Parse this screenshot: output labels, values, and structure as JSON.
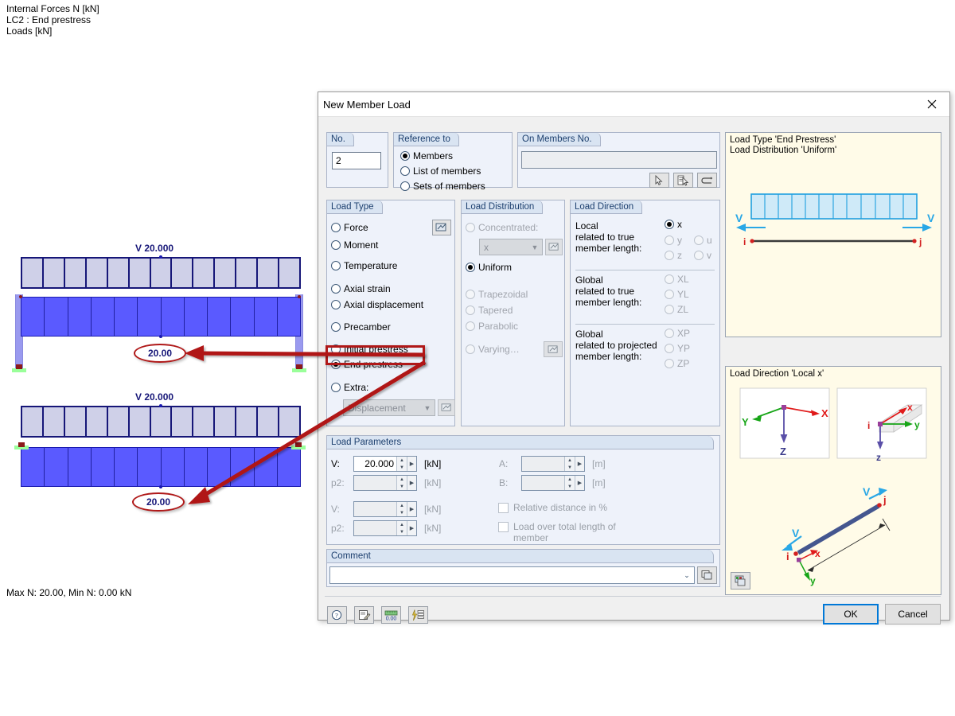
{
  "background": {
    "legend": "Internal Forces N [kN]\nLC2 : End prestress\nLoads [kN]",
    "status": "Max N: 20.00, Min N: 0.00 kN",
    "beam1_label": "V 20.000",
    "beam1_value": "20.00",
    "beam2_label": "V 20.000",
    "beam2_value": "20.00"
  },
  "dialog": {
    "title": "New Member Load",
    "close_icon": "close-icon",
    "no": {
      "title": "No.",
      "value": "2"
    },
    "reference_to": {
      "title": "Reference to",
      "options": [
        {
          "label": "Members",
          "selected": true
        },
        {
          "label": "List of members",
          "selected": false
        },
        {
          "label": "Sets of members",
          "selected": false
        }
      ]
    },
    "on_members": {
      "title": "On Members No.",
      "value": "",
      "buttons": [
        {
          "name": "pick-members-icon"
        },
        {
          "name": "pick-members-list-icon"
        },
        {
          "name": "undo-selection-icon"
        }
      ]
    },
    "load_type": {
      "title": "Load Type",
      "options": [
        {
          "label": "Force",
          "selected": false,
          "disabled": false
        },
        {
          "label": "Moment",
          "selected": false,
          "disabled": false
        },
        {
          "label": "Temperature",
          "selected": false,
          "disabled": false
        },
        {
          "label": "Axial strain",
          "selected": false,
          "disabled": false
        },
        {
          "label": "Axial displacement",
          "selected": false,
          "disabled": false
        },
        {
          "label": "Precamber",
          "selected": false,
          "disabled": false
        },
        {
          "label": "Initial prestress",
          "selected": false,
          "disabled": false
        },
        {
          "label": "End prestress",
          "selected": true,
          "disabled": false
        },
        {
          "label": "Extra:",
          "selected": false,
          "disabled": false
        }
      ],
      "extra_combo_value": "Displacement",
      "highlighted_option": "End prestress"
    },
    "load_distribution": {
      "title": "Load Distribution",
      "options": [
        {
          "label": "Concentrated:",
          "selected": false,
          "disabled": true
        },
        {
          "label": "Uniform",
          "selected": true,
          "disabled": false
        },
        {
          "label": "Trapezoidal",
          "selected": false,
          "disabled": true
        },
        {
          "label": "Tapered",
          "selected": false,
          "disabled": true
        },
        {
          "label": "Parabolic",
          "selected": false,
          "disabled": true
        },
        {
          "label": "Varying…",
          "selected": false,
          "disabled": true
        }
      ],
      "concentrated_combo_value": "x"
    },
    "load_direction": {
      "title": "Load Direction",
      "groups": [
        {
          "label": "Local\nrelated to true\nmember length:",
          "options": [
            {
              "label": "x",
              "selected": true,
              "disabled": false
            },
            {
              "label": "y",
              "selected": false,
              "disabled": true
            },
            {
              "label": "u",
              "selected": false,
              "disabled": true
            },
            {
              "label": "z",
              "selected": false,
              "disabled": true
            },
            {
              "label": "v",
              "selected": false,
              "disabled": true
            }
          ]
        },
        {
          "label": "Global\nrelated to true\nmember length:",
          "options": [
            {
              "label": "XL",
              "selected": false,
              "disabled": true
            },
            {
              "label": "YL",
              "selected": false,
              "disabled": true
            },
            {
              "label": "ZL",
              "selected": false,
              "disabled": true
            }
          ]
        },
        {
          "label": "Global\nrelated to projected\nmember length:",
          "options": [
            {
              "label": "XP",
              "selected": false,
              "disabled": true
            },
            {
              "label": "YP",
              "selected": false,
              "disabled": true
            },
            {
              "label": "ZP",
              "selected": false,
              "disabled": true
            }
          ]
        }
      ]
    },
    "load_parameters": {
      "title": "Load Parameters",
      "fields": [
        {
          "label": "V:",
          "value": "20.000",
          "unit": "[kN]",
          "disabled": false
        },
        {
          "label": "p2:",
          "value": "",
          "unit": "[kN]",
          "disabled": true
        },
        {
          "label": "V:",
          "value": "",
          "unit": "[kN]",
          "disabled": true
        },
        {
          "label": "p2:",
          "value": "",
          "unit": "[kN]",
          "disabled": true
        },
        {
          "label": "A:",
          "value": "",
          "unit": "[m]",
          "disabled": true
        },
        {
          "label": "B:",
          "value": "",
          "unit": "[m]",
          "disabled": true
        }
      ],
      "checkboxes": [
        {
          "label": "Relative distance in %",
          "checked": false,
          "disabled": true
        },
        {
          "label": "Load over total length of member",
          "checked": false,
          "disabled": true
        }
      ]
    },
    "comment": {
      "title": "Comment",
      "value": "",
      "button_icon": "comment-library-icon"
    },
    "footer_icons": [
      {
        "name": "help-icon"
      },
      {
        "name": "edit-note-icon"
      },
      {
        "name": "units-icon"
      },
      {
        "name": "settings-list-icon"
      }
    ],
    "buttons": {
      "ok": "OK",
      "cancel": "Cancel"
    },
    "preview_top": {
      "title": "Load Type 'End Prestress'\nLoad Distribution 'Uniform'",
      "labels": {
        "v_left": "V",
        "v_right": "V",
        "node_i": "i",
        "node_j": "j"
      }
    },
    "preview_bottom": {
      "title": "Load Direction 'Local x'",
      "axes_global": {
        "x": "X",
        "y": "Y",
        "z": "Z"
      },
      "axes_local": {
        "x": "x",
        "y": "y",
        "z": "z",
        "node_i": "i"
      },
      "member": {
        "node_i": "i",
        "node_j": "j",
        "v_left": "V",
        "v_right": "V",
        "x": "x",
        "y": "y"
      },
      "button_icon": "preview-settings-icon"
    }
  },
  "colors": {
    "accent": "#0078d7",
    "annotation_red": "#b01818",
    "beam_blue": "#5a5aff",
    "beam_outline": "#161678",
    "panel_bg": "#eef2fa",
    "group_header": "#d9e4f2",
    "preview_bg": "#fffbe8"
  }
}
